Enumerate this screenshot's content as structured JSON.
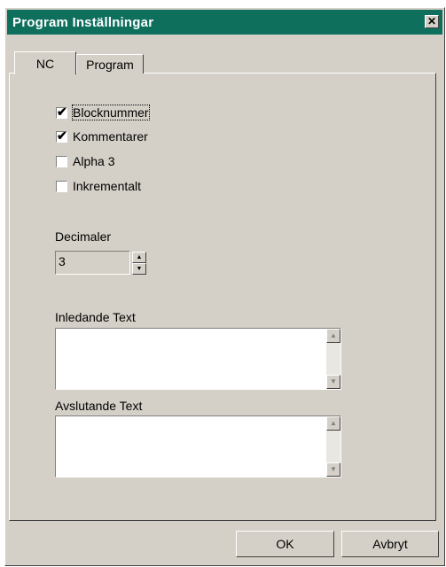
{
  "window": {
    "title": "Program Inställningar",
    "close_icon": "close-icon"
  },
  "tabs": [
    {
      "label": "NC",
      "active": true
    },
    {
      "label": "Program",
      "active": false
    }
  ],
  "checkboxes": [
    {
      "label": "Blocknummer",
      "checked": true
    },
    {
      "label": "Kommentarer",
      "checked": true
    },
    {
      "label": "Alpha 3",
      "checked": false
    },
    {
      "label": "Inkrementalt",
      "checked": false
    }
  ],
  "decimals": {
    "label": "Decimaler",
    "value": "3"
  },
  "intro_text": {
    "label": "Inledande Text",
    "value": ""
  },
  "closing_text": {
    "label": "Avslutande Text",
    "value": ""
  },
  "buttons": {
    "ok": "OK",
    "cancel": "Avbryt"
  },
  "glyphs": {
    "check": "✔",
    "up": "▲",
    "down": "▼",
    "close": "✕"
  }
}
